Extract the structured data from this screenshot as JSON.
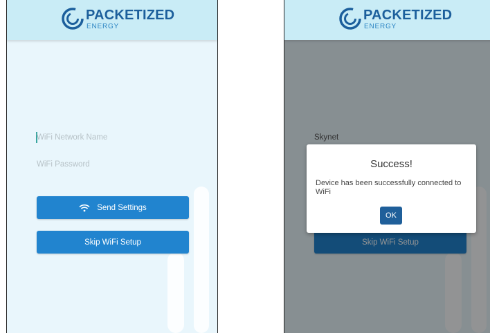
{
  "brand": {
    "name": "PACKETIZED",
    "sub": "ENERGY"
  },
  "left_screen": {
    "wifi_name_placeholder": "WiFi Network Name",
    "wifi_password_placeholder": "WiFi Password",
    "send_button": "Send Settings",
    "skip_button": "Skip WiFi Setup"
  },
  "right_screen": {
    "wifi_name_value": "Skynet",
    "skip_button": "Skip WiFi Setup",
    "dialog": {
      "title": "Success!",
      "message": "Device has been successfully connected to WiFi",
      "ok_label": "OK"
    }
  },
  "colors": {
    "header": "#c9ecf6",
    "body": "#e9f6fc",
    "button": "#2184cf",
    "dialog_button": "#1f5f9a",
    "brand": "#1c5f9c"
  }
}
